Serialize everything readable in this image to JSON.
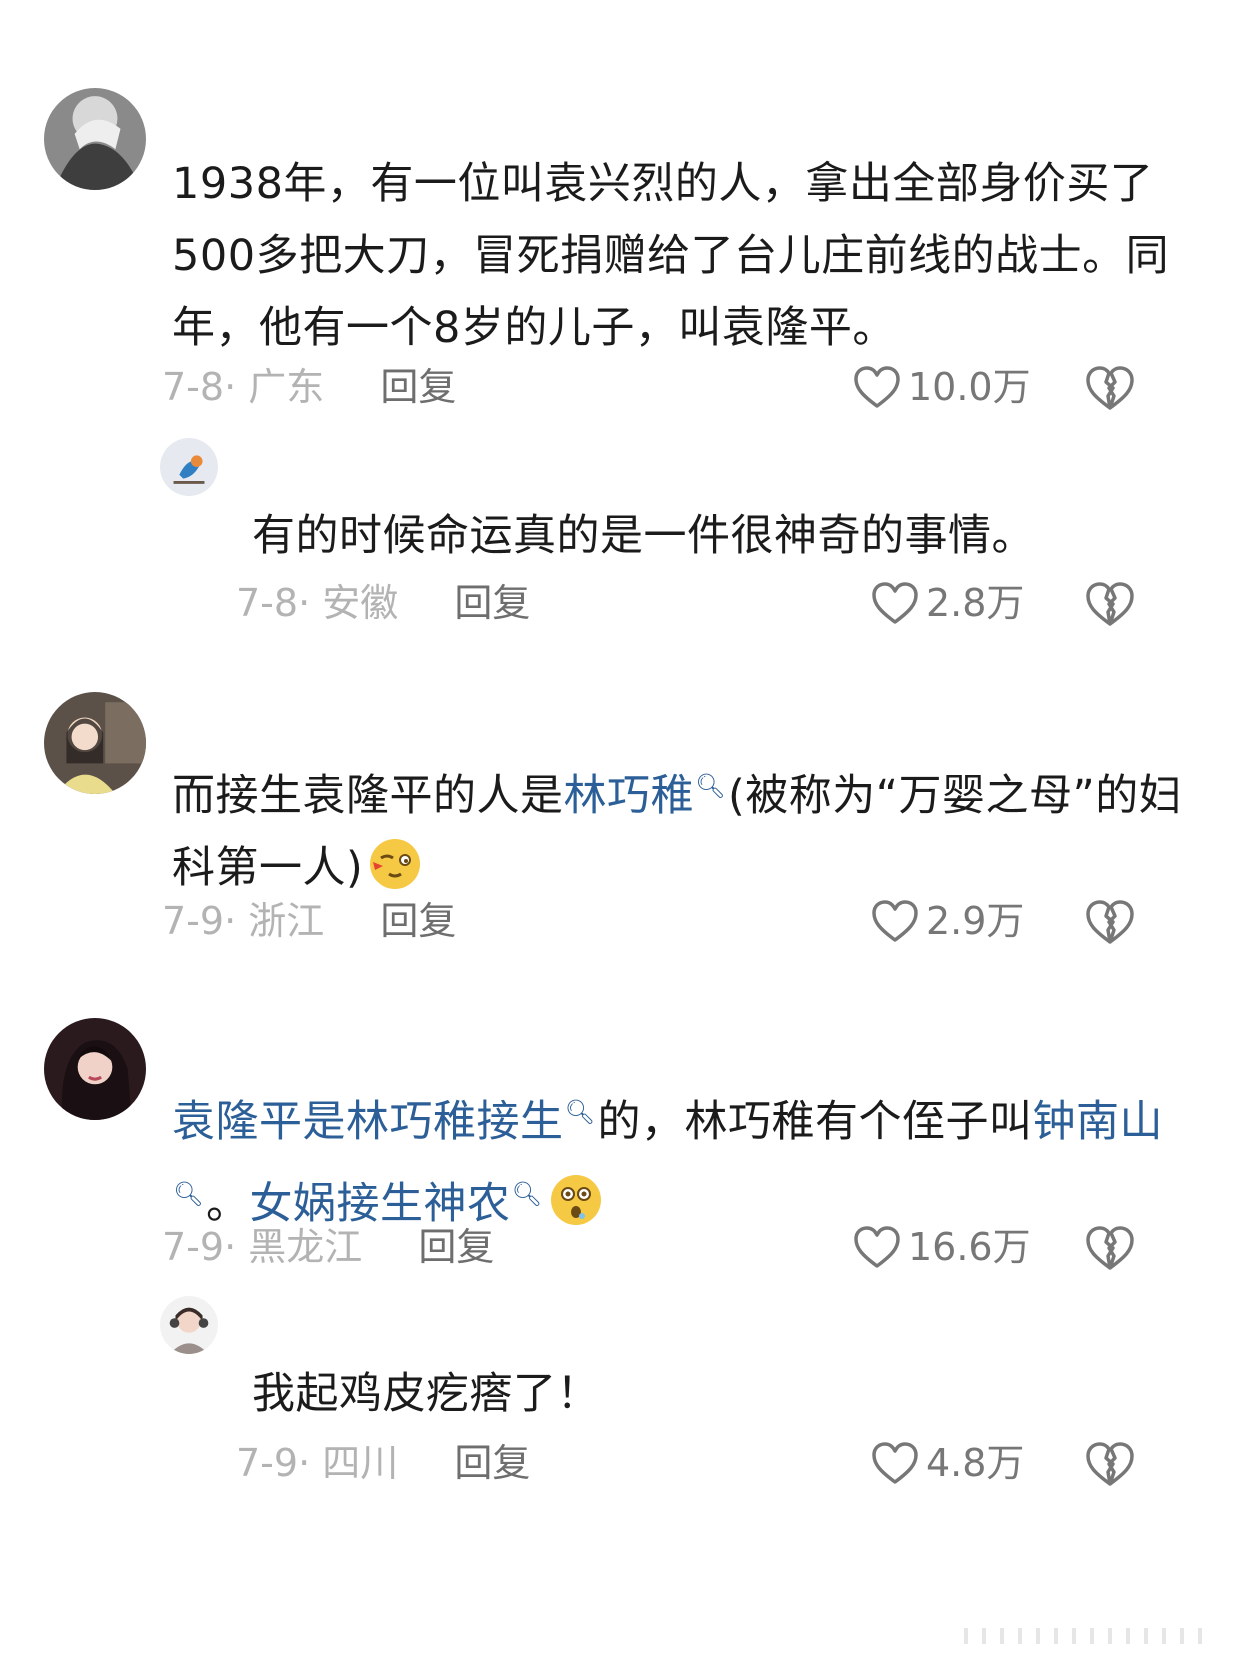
{
  "comments": [
    {
      "text": "1938年，有一位叫袁兴烈的人，拿出全部身价买了500多把大刀，冒死捐赠给了台儿庄前线的战士。同年，他有一个8岁的儿子，叫袁隆平。",
      "date": "7-8",
      "location": "广东",
      "reply_label": "回复",
      "likes": "10.0万",
      "like_icon": "heart-outline-icon",
      "dislike_icon": "broken-heart-icon",
      "reply": {
        "text": "有的时候命运真的是一件很神奇的事情。",
        "date": "7-8",
        "location": "安徽",
        "reply_label": "回复",
        "likes": "2.8万"
      }
    },
    {
      "text_parts": [
        "而接生袁隆平的人是",
        "林巧稚",
        "(被称为“万婴之母”的妇科第一人)"
      ],
      "emoji": "wink-kiss-emoji",
      "date": "7-9",
      "location": "浙江",
      "reply_label": "回复",
      "likes": "2.9万"
    },
    {
      "text_parts": [
        "袁隆平是林巧稚接生",
        "的，林巧稚有个侄子叫",
        "钟南山",
        "。",
        "女娲接生神农"
      ],
      "emoji": "surprised-emoji",
      "date": "7-9",
      "location": "黑龙江",
      "reply_label": "回复",
      "likes": "16.6万",
      "reply": {
        "text": "我起鸡皮疙瘩了！",
        "date": "7-9",
        "location": "四川",
        "reply_label": "回复",
        "likes": "4.8万"
      }
    }
  ],
  "search_icon": "search-icon",
  "colors": {
    "link": "#2c5f97",
    "meta": "#b3b3b3",
    "reply": "#6e6e6e",
    "text": "#1b1b1b"
  }
}
